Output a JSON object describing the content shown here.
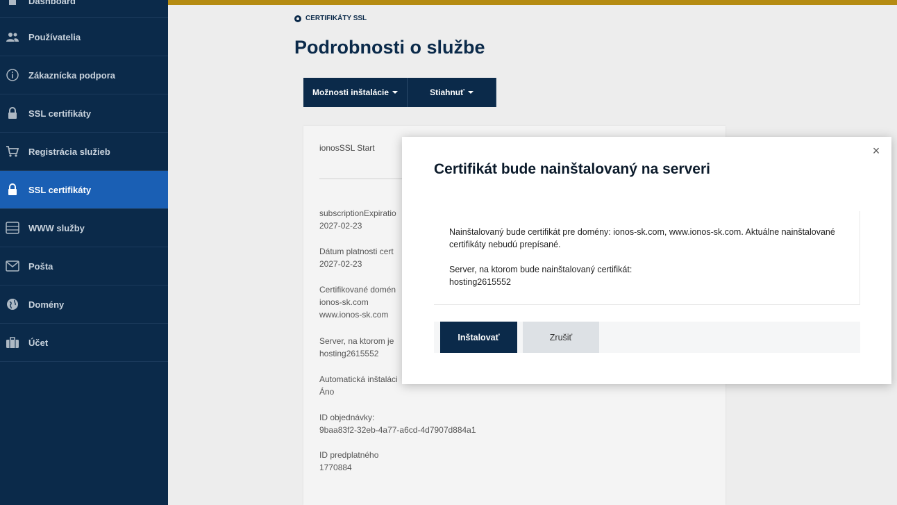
{
  "sidebar": {
    "items": [
      {
        "label": "Dashboard",
        "icon": "home-icon"
      },
      {
        "label": "Používatelia",
        "icon": "users-icon"
      },
      {
        "label": "Zákaznícka podpora",
        "icon": "info-icon"
      },
      {
        "label": "SSL certifikáty",
        "icon": "lock-icon"
      },
      {
        "label": "Registrácia služieb",
        "icon": "cart-icon"
      },
      {
        "label": "SSL certifikáty",
        "icon": "lock-icon"
      },
      {
        "label": "WWW služby",
        "icon": "server-icon"
      },
      {
        "label": "Pošta",
        "icon": "mail-icon"
      },
      {
        "label": "Domény",
        "icon": "globe-icon"
      },
      {
        "label": "Účet",
        "icon": "briefcase-icon"
      }
    ]
  },
  "breadcrumb": "CERTIFIKÁTY SSL",
  "page_title": "Podrobnosti o službe",
  "buttons": {
    "install_options": "Možnosti inštalácie",
    "download": "Stiahnuť"
  },
  "card": {
    "title": "ionosSSL Start",
    "fields": [
      {
        "label": "subscriptionExpiratio",
        "value": "2027-02-23"
      },
      {
        "label": "Dátum platnosti cert",
        "value": "2027-02-23"
      },
      {
        "label": "Certifikované domén",
        "value": "ionos-sk.com",
        "value2": "www.ionos-sk.com"
      },
      {
        "label": "Server, na ktorom je",
        "value": "hosting2615552"
      },
      {
        "label": "Automatická inštaláci",
        "value": "Áno"
      },
      {
        "label": "ID objednávky:",
        "value": "9baa83f2-32eb-4a77-a6cd-4d7907d884a1"
      },
      {
        "label": "ID predplatného",
        "value": "1770884"
      }
    ]
  },
  "modal": {
    "title": "Certifikát bude nainštalovaný na serveri",
    "message": "Nainštalovaný bude certifikát pre domény: ionos-sk.com, www.ionos-sk.com. Aktuálne nainštalované certifikáty nebudú prepísané.",
    "server_label": "Server, na ktorom bude nainštalovaný certifikát:",
    "server_value": "hosting2615552",
    "install_label": "Inštalovať",
    "cancel_label": "Zrušiť",
    "close_glyph": "×"
  },
  "colors": {
    "sidebar_bg": "#0b2a4a",
    "active_item": "#1a5fb4",
    "primary_button": "#0b2a4a",
    "accent_bar": "#b58b12"
  }
}
